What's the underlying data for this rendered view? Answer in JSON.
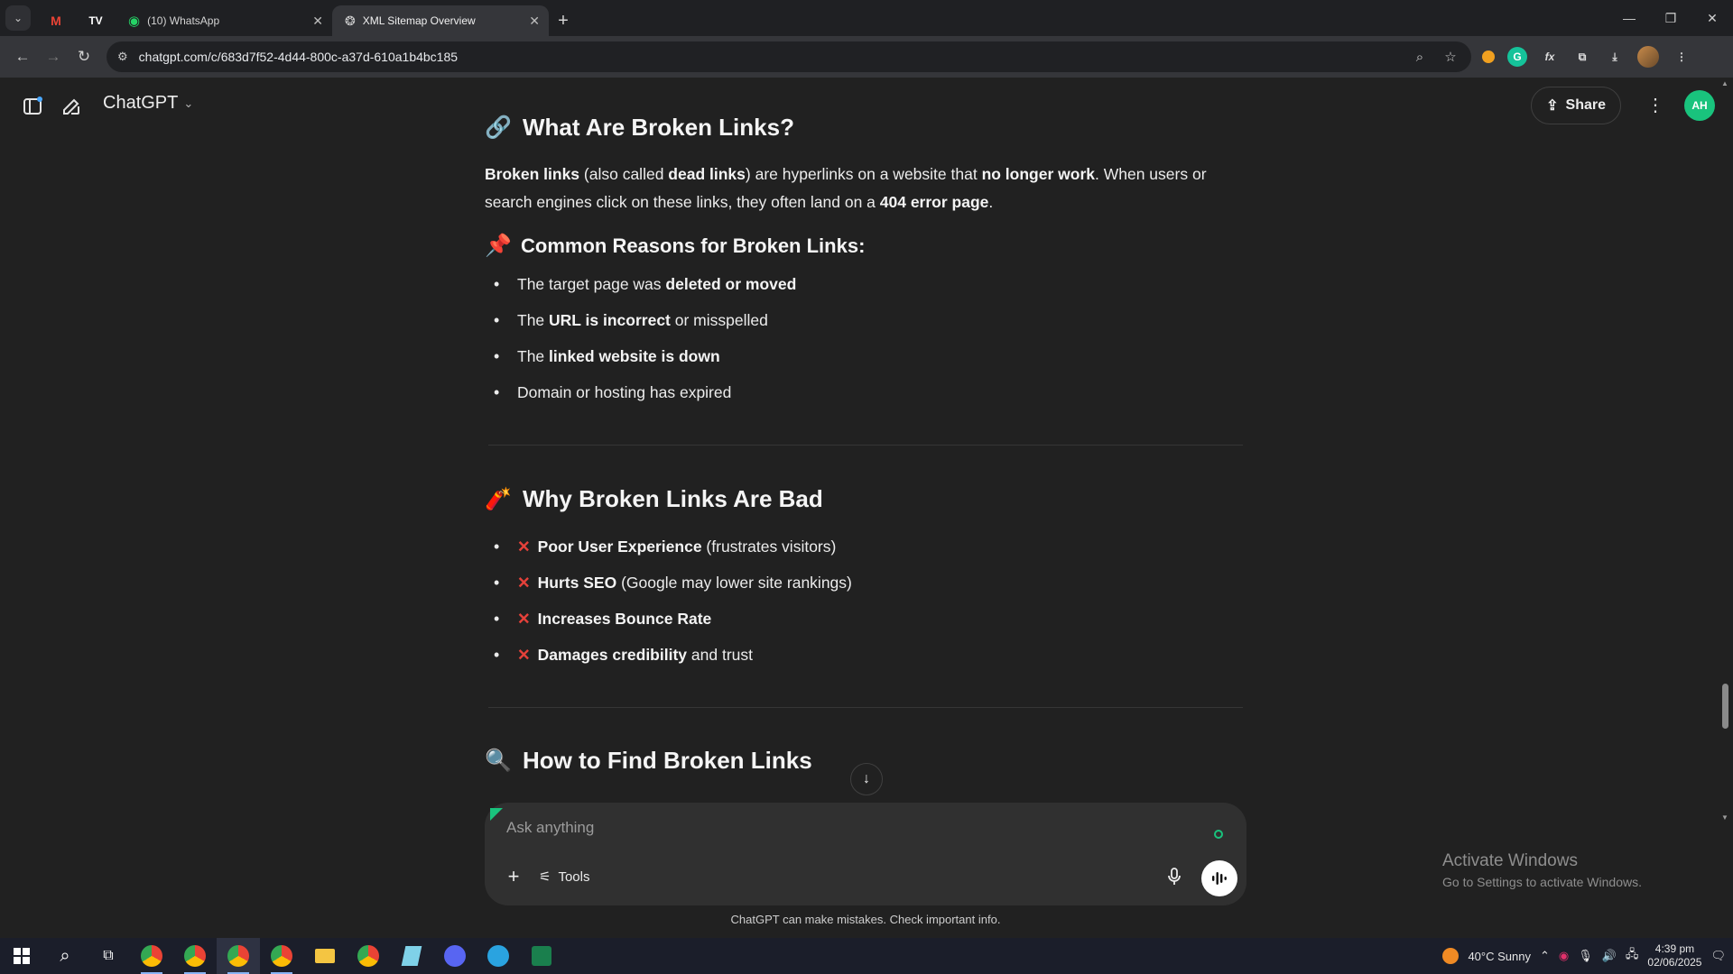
{
  "browser": {
    "tabs": [
      {
        "title": "",
        "icon": "gmail-icon"
      },
      {
        "title": "",
        "icon": "tw-icon"
      },
      {
        "title": "(10) WhatsApp",
        "icon": "whatsapp-icon"
      },
      {
        "title": "XML Sitemap Overview",
        "icon": "chatgpt-icon",
        "active": true
      }
    ],
    "url": "chatgpt.com/c/683d7f52-4d44-800c-a37d-610a1b4bc185"
  },
  "app": {
    "model_label": "ChatGPT",
    "share_label": "Share",
    "avatar_initials": "AH"
  },
  "article": {
    "section1": {
      "title": "What Are Broken Links?",
      "emoji": "🔗",
      "para_parts": [
        "Broken links",
        " (also called ",
        "dead links",
        ") are hyperlinks on a website that ",
        "no longer work",
        ". When users or search engines click on these links, they often land on a ",
        "404 error page",
        "."
      ],
      "sub_title": "Common Reasons for Broken Links:",
      "sub_emoji": "📌",
      "reasons": [
        {
          "pre": "The target page was ",
          "bold": "deleted or moved",
          "post": ""
        },
        {
          "pre": "The ",
          "bold": "URL is incorrect",
          "post": " or misspelled"
        },
        {
          "pre": "The ",
          "bold": "linked website is down",
          "post": ""
        },
        {
          "pre": "Domain or hosting has expired",
          "bold": "",
          "post": ""
        }
      ]
    },
    "section2": {
      "title": "Why Broken Links Are Bad",
      "emoji": "🧨",
      "mark": "✕",
      "items": [
        {
          "bold": "Poor User Experience",
          "post": " (frustrates visitors)"
        },
        {
          "bold": "Hurts SEO",
          "post": " (Google may lower site rankings)"
        },
        {
          "bold": "Increases Bounce Rate",
          "post": ""
        },
        {
          "bold": "Damages credibility",
          "post": " and trust"
        }
      ]
    },
    "section3": {
      "title": "How to Find Broken Links",
      "emoji": "🔍"
    }
  },
  "composer": {
    "placeholder": "Ask anything",
    "tools_label": "Tools",
    "disclaimer": "ChatGPT can make mistakes. Check important info."
  },
  "watermark": {
    "line1": "Activate Windows",
    "line2": "Go to Settings to activate Windows."
  },
  "taskbar": {
    "weather": "40°C  Sunny",
    "time": "4:39 pm",
    "date": "02/06/2025"
  }
}
